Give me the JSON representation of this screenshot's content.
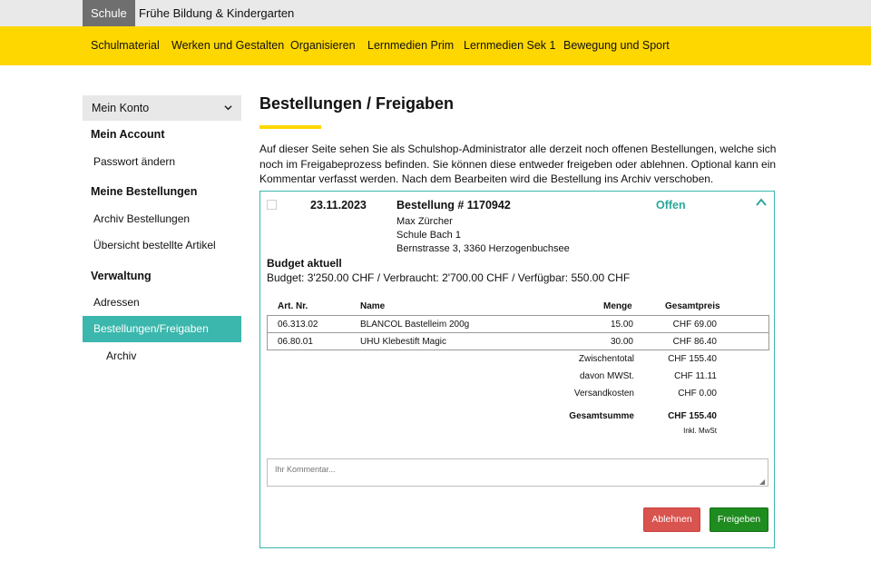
{
  "topbar": {
    "tabs": [
      {
        "label": "Schule",
        "active": true
      },
      {
        "label": "Frühe Bildung & Kindergarten",
        "active": false
      }
    ]
  },
  "mainnav": {
    "items": [
      "Schulmaterial",
      "Werken und Gestalten",
      "Organisieren",
      "Lernmedien Prim",
      "Lernmedien Sek 1",
      "Bewegung und Sport"
    ]
  },
  "sidebar": {
    "account_select": "Mein Konto",
    "my_account_heading": "Mein Account",
    "change_password": "Passwort ändern",
    "my_orders_heading": "Meine Bestellungen",
    "order_archive": "Archiv Bestellungen",
    "ordered_items": "Übersicht bestellte Artikel",
    "admin_heading": "Verwaltung",
    "addresses": "Adressen",
    "approvals": "Bestellungen/Freigaben",
    "archive": "Archiv"
  },
  "main": {
    "title": "Bestellungen / Freigaben",
    "intro": "Auf dieser Seite sehen Sie als Schulshop-Administrator alle derzeit noch offenen Bestellungen, welche sich noch im Freigabeprozess befinden. Sie können diese entweder freigeben oder ablehnen. Optional kann ein Kommentar verfasst werden. Nach dem Bearbeiten wird die Bestellung ins Archiv verschoben."
  },
  "order": {
    "date": "23.11.2023",
    "number": "Bestellung # 1170942",
    "status": "Offen",
    "address": [
      "Max Zürcher",
      "Schule Bach 1",
      "Bernstrasse 3, 3360 Herzogenbuchsee"
    ],
    "budget_heading": "Budget aktuell",
    "budget_text": "Budget:  3'250.00 CHF / Verbraucht: 2'700.00 CHF / Verfügbar: 550.00 CHF",
    "columns": {
      "art_nr": "Art. Nr.",
      "name": "Name",
      "qty": "Menge",
      "total": "Gesamtpreis"
    },
    "items": [
      {
        "art_nr": "06.313.02",
        "name": "BLANCOL Bastelleim 200g",
        "qty": "15.00",
        "total": "CHF 69.00"
      },
      {
        "art_nr": "06.80.01",
        "name": "UHU Klebestift Magic",
        "qty": "30.00",
        "total": "CHF 86.40"
      }
    ],
    "summary": {
      "subtotal_label": "Zwischentotal",
      "subtotal": "CHF 155.40",
      "vat_label": "davon MWSt.",
      "vat": "CHF 11.11",
      "shipping_label": "Versandkosten",
      "shipping": "CHF 0.00",
      "grand_label": "Gesamtsumme",
      "grand": "CHF 155.40",
      "incl_vat": "Inkl. MwSt"
    },
    "comment_placeholder": "Ihr Kommentar...",
    "reject_label": "Ablehnen",
    "approve_label": "Freigeben"
  },
  "colors": {
    "accent_yellow": "#fed700",
    "accent_teal": "#3bb7ad",
    "reject": "#d9534f",
    "approve": "#1e8c1e"
  },
  "icons": {
    "account_chevron": "chevron-down-icon",
    "order_toggle": "chevron-up-icon"
  }
}
